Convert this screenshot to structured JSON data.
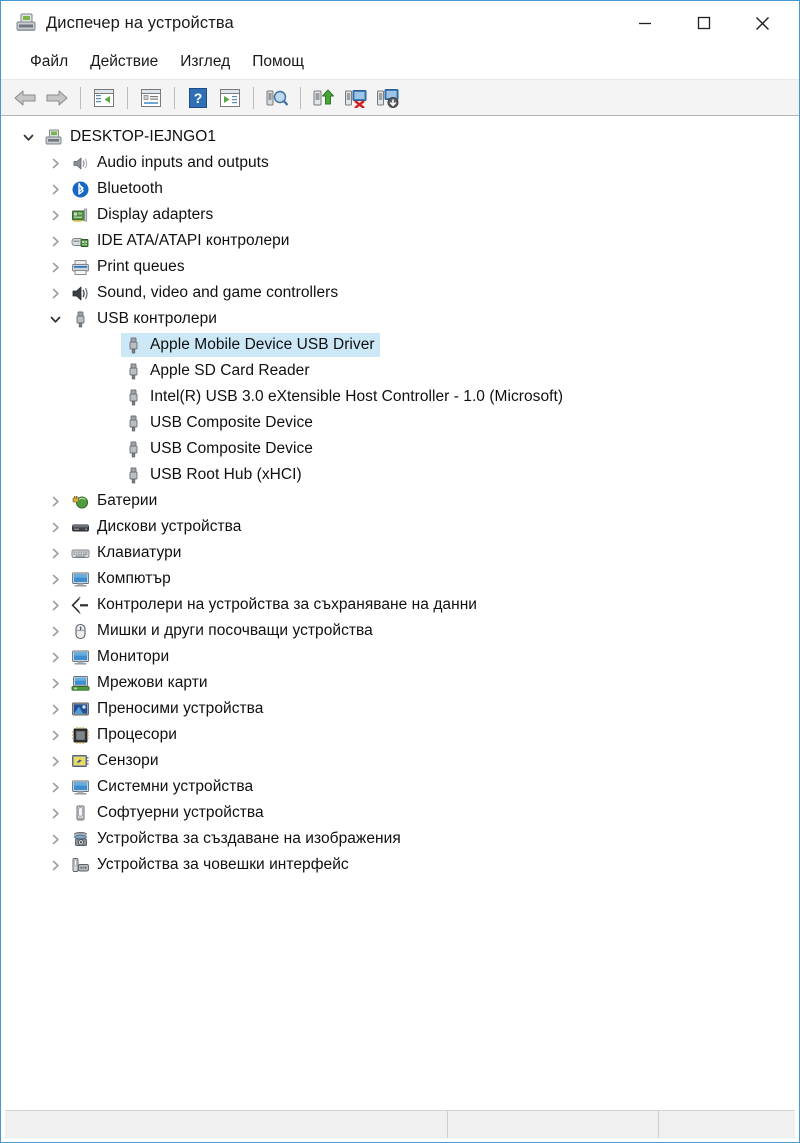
{
  "window": {
    "title": "Диспечер на устройства",
    "icon": "device-manager-icon",
    "controls": {
      "minimize": "—",
      "maximize": "□",
      "close": "✕"
    },
    "accent_border_color": "#4b97d2"
  },
  "menubar": {
    "items": [
      {
        "label": "Файл"
      },
      {
        "label": "Действие"
      },
      {
        "label": "Изглед"
      },
      {
        "label": "Помощ"
      }
    ]
  },
  "toolbar": {
    "buttons": [
      {
        "name": "back-arrow-icon"
      },
      {
        "name": "forward-arrow-icon"
      },
      {
        "name": "separator"
      },
      {
        "name": "show-hide-console-tree-icon"
      },
      {
        "name": "separator"
      },
      {
        "name": "properties-icon"
      },
      {
        "name": "separator"
      },
      {
        "name": "help-icon"
      },
      {
        "name": "show-action-pane-icon"
      },
      {
        "name": "separator"
      },
      {
        "name": "scan-for-hardware-changes-icon"
      },
      {
        "name": "separator"
      },
      {
        "name": "update-driver-icon"
      },
      {
        "name": "uninstall-device-icon"
      },
      {
        "name": "enable-device-icon"
      }
    ]
  },
  "tree": {
    "selection_color": "#cce8f7",
    "nodes": [
      {
        "label": "DESKTOP-IEJNGO1",
        "depth": 0,
        "state": "expanded",
        "icon": "computer-root-icon",
        "selected": false
      },
      {
        "label": "Audio inputs and outputs",
        "depth": 1,
        "state": "collapsed",
        "icon": "speaker-icon",
        "selected": false
      },
      {
        "label": "Bluetooth",
        "depth": 1,
        "state": "collapsed",
        "icon": "bluetooth-icon",
        "selected": false
      },
      {
        "label": "Display adapters",
        "depth": 1,
        "state": "collapsed",
        "icon": "display-adapter-icon",
        "selected": false
      },
      {
        "label": "IDE ATA/ATAPI контролери",
        "depth": 1,
        "state": "collapsed",
        "icon": "ide-controller-icon",
        "selected": false
      },
      {
        "label": "Print queues",
        "depth": 1,
        "state": "collapsed",
        "icon": "printer-icon",
        "selected": false
      },
      {
        "label": "Sound, video and game controllers",
        "depth": 1,
        "state": "collapsed",
        "icon": "sound-video-icon",
        "selected": false
      },
      {
        "label": "USB контролери",
        "depth": 1,
        "state": "expanded",
        "icon": "usb-icon",
        "selected": false
      },
      {
        "label": "Apple Mobile Device USB Driver",
        "depth": 2,
        "state": "leaf",
        "icon": "usb-icon",
        "selected": true
      },
      {
        "label": "Apple SD Card Reader",
        "depth": 2,
        "state": "leaf",
        "icon": "usb-icon",
        "selected": false
      },
      {
        "label": "Intel(R) USB 3.0 eXtensible Host Controller - 1.0 (Microsoft)",
        "depth": 2,
        "state": "leaf",
        "icon": "usb-icon",
        "selected": false
      },
      {
        "label": "USB Composite Device",
        "depth": 2,
        "state": "leaf",
        "icon": "usb-icon",
        "selected": false
      },
      {
        "label": "USB Composite Device",
        "depth": 2,
        "state": "leaf",
        "icon": "usb-icon",
        "selected": false
      },
      {
        "label": "USB Root Hub (xHCI)",
        "depth": 2,
        "state": "leaf",
        "icon": "usb-icon",
        "selected": false
      },
      {
        "label": "Батерии",
        "depth": 1,
        "state": "collapsed",
        "icon": "battery-icon",
        "selected": false
      },
      {
        "label": "Дискови устройства",
        "depth": 1,
        "state": "collapsed",
        "icon": "disk-drive-icon",
        "selected": false
      },
      {
        "label": "Клавиатури",
        "depth": 1,
        "state": "collapsed",
        "icon": "keyboard-icon",
        "selected": false
      },
      {
        "label": "Компютър",
        "depth": 1,
        "state": "collapsed",
        "icon": "computer-icon",
        "selected": false
      },
      {
        "label": "Контролери на устройства за съхраняване на данни",
        "depth": 1,
        "state": "collapsed",
        "icon": "storage-controller-icon",
        "selected": false
      },
      {
        "label": "Мишки и други посочващи устройства",
        "depth": 1,
        "state": "collapsed",
        "icon": "mouse-icon",
        "selected": false
      },
      {
        "label": "Монитори",
        "depth": 1,
        "state": "collapsed",
        "icon": "monitor-icon",
        "selected": false
      },
      {
        "label": "Мрежови карти",
        "depth": 1,
        "state": "collapsed",
        "icon": "network-adapter-icon",
        "selected": false
      },
      {
        "label": "Преносими устройства",
        "depth": 1,
        "state": "collapsed",
        "icon": "portable-device-icon",
        "selected": false
      },
      {
        "label": "Процесори",
        "depth": 1,
        "state": "collapsed",
        "icon": "processor-icon",
        "selected": false
      },
      {
        "label": "Сензори",
        "depth": 1,
        "state": "collapsed",
        "icon": "sensor-icon",
        "selected": false
      },
      {
        "label": "Системни устройства",
        "depth": 1,
        "state": "collapsed",
        "icon": "system-device-icon",
        "selected": false
      },
      {
        "label": "Софтуерни устройства",
        "depth": 1,
        "state": "collapsed",
        "icon": "software-device-icon",
        "selected": false
      },
      {
        "label": "Устройства за създаване на изображения",
        "depth": 1,
        "state": "collapsed",
        "icon": "imaging-device-icon",
        "selected": false
      },
      {
        "label": "Устройства за човешки интерфейс",
        "depth": 1,
        "state": "collapsed",
        "icon": "hid-device-icon",
        "selected": false
      }
    ]
  },
  "statusbar": {
    "panes": [
      {
        "text": ""
      },
      {
        "text": ""
      },
      {
        "text": ""
      }
    ]
  }
}
